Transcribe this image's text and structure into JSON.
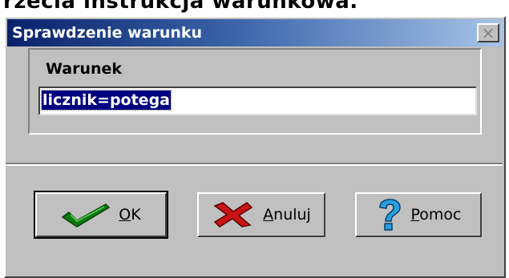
{
  "background": {
    "heading_fragment": "rzecia  instrukcja warunkowa."
  },
  "dialog": {
    "title": "Sprawdzenie warunku",
    "close_glyph": "×"
  },
  "group": {
    "label": "Warunek",
    "input_value": "licznik=potega"
  },
  "buttons": {
    "ok": {
      "accel": "O",
      "rest": "K",
      "icon": "check-icon"
    },
    "cancel": {
      "accel": "A",
      "rest": "nuluj",
      "icon": "x-icon"
    },
    "help": {
      "accel": "P",
      "rest": "omoc",
      "icon": "question-mark-icon"
    }
  },
  "colors": {
    "title_start": "#08216b",
    "title_end": "#a6c4e8",
    "selection": "#000080",
    "face": "#c0c0c0"
  }
}
